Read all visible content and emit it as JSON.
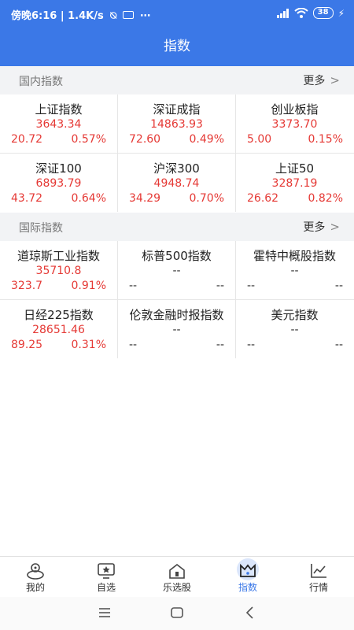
{
  "status_bar": {
    "time_text": "傍晚6:16 | 1.4K/s",
    "battery": "38"
  },
  "header": {
    "title": "指数"
  },
  "domestic": {
    "label": "国内指数",
    "more": "更多",
    "items": [
      {
        "name": "上证指数",
        "price": "3643.34",
        "change": "20.72",
        "pct": "0.57%"
      },
      {
        "name": "深证成指",
        "price": "14863.93",
        "change": "72.60",
        "pct": "0.49%"
      },
      {
        "name": "创业板指",
        "price": "3373.70",
        "change": "5.00",
        "pct": "0.15%"
      },
      {
        "name": "深证100",
        "price": "6893.79",
        "change": "43.72",
        "pct": "0.64%"
      },
      {
        "name": "沪深300",
        "price": "4948.74",
        "change": "34.29",
        "pct": "0.70%"
      },
      {
        "name": "上证50",
        "price": "3287.19",
        "change": "26.62",
        "pct": "0.82%"
      }
    ]
  },
  "international": {
    "label": "国际指数",
    "more": "更多",
    "items": [
      {
        "name": "道琼斯工业指数",
        "price": "35710.8",
        "change": "323.7",
        "pct": "0.91%"
      },
      {
        "name": "标普500指数",
        "price": "--",
        "change": "--",
        "pct": "--"
      },
      {
        "name": "霍特中概股指数",
        "price": "--",
        "change": "--",
        "pct": "--"
      },
      {
        "name": "日经225指数",
        "price": "28651.46",
        "change": "89.25",
        "pct": "0.31%"
      },
      {
        "name": "伦敦金融时报指数",
        "price": "--",
        "change": "--",
        "pct": "--"
      },
      {
        "name": "美元指数",
        "price": "--",
        "change": "--",
        "pct": "--"
      }
    ]
  },
  "tabs": [
    {
      "label": "我的",
      "icon": "profile-icon"
    },
    {
      "label": "自选",
      "icon": "watchlist-icon"
    },
    {
      "label": "乐选股",
      "icon": "stock-picker-icon"
    },
    {
      "label": "指数",
      "icon": "index-icon",
      "active": true
    },
    {
      "label": "行情",
      "icon": "market-chart-icon"
    }
  ],
  "colors": {
    "accent": "#3b78e7",
    "up": "#e53935"
  }
}
